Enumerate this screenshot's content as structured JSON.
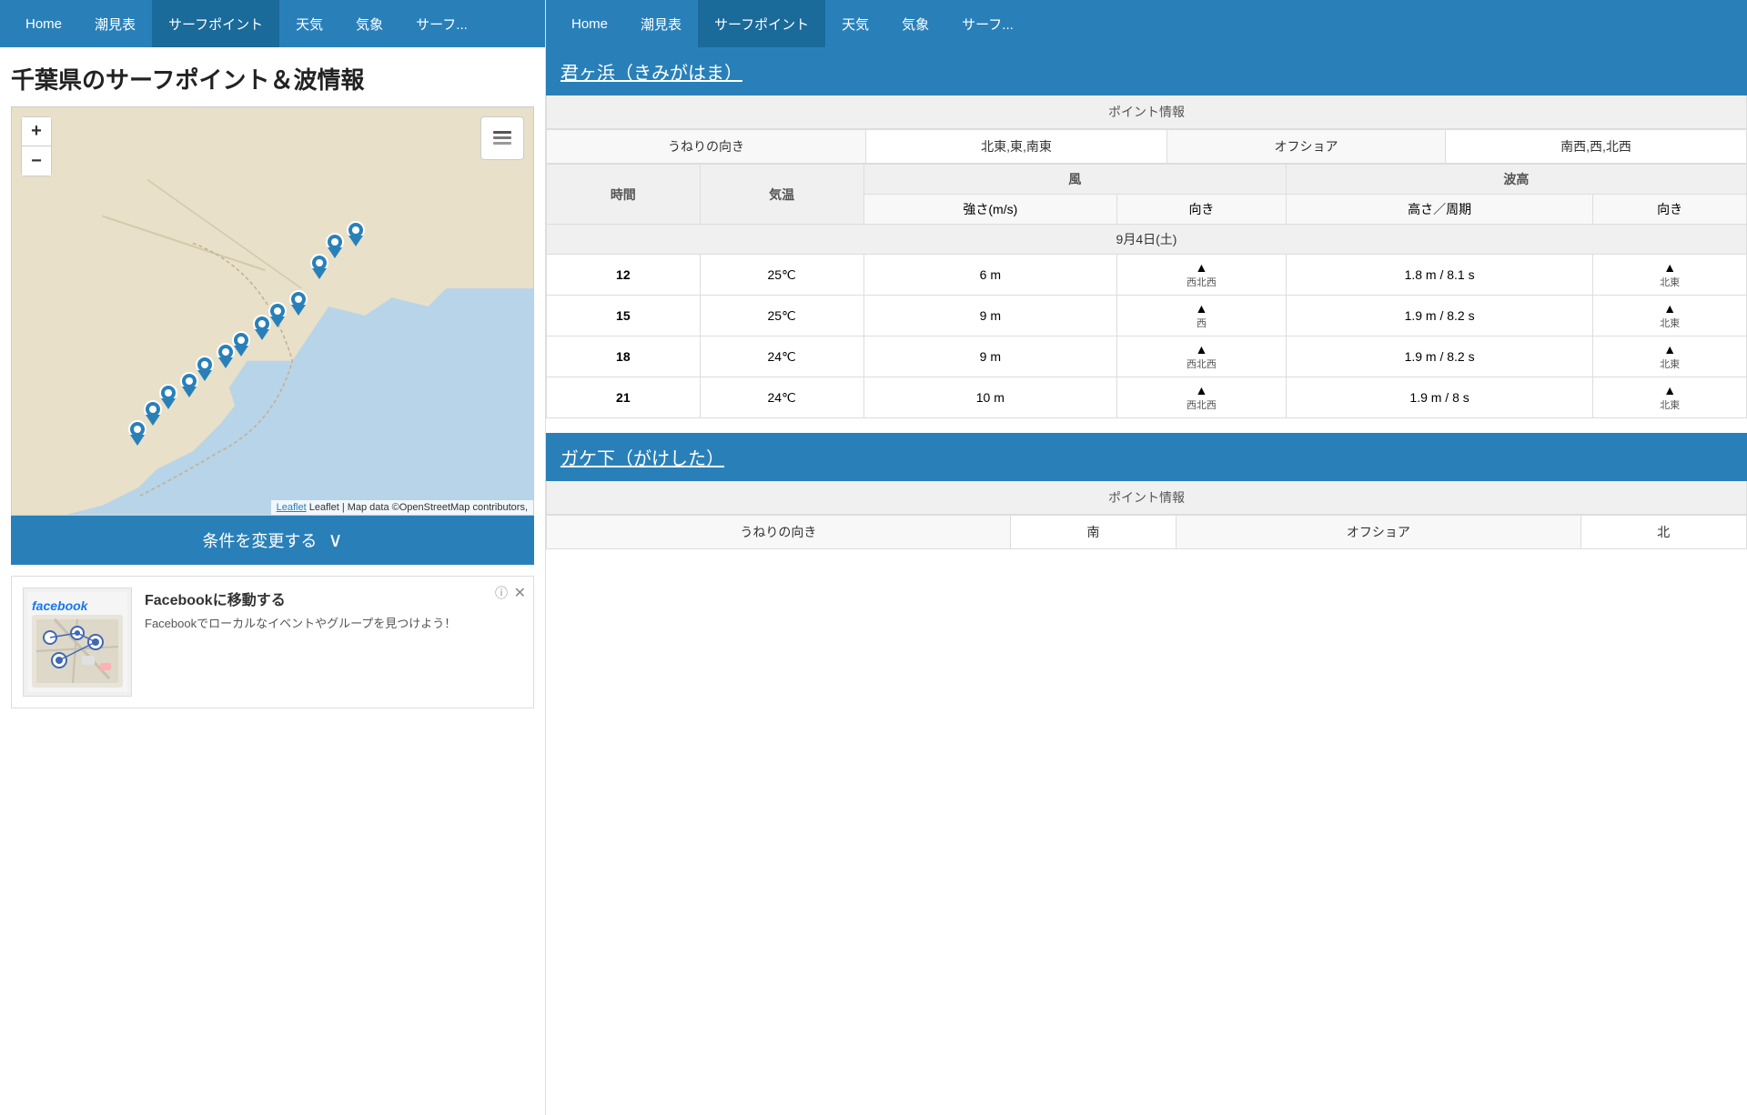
{
  "nav": {
    "items": [
      {
        "label": "Home",
        "active": false
      },
      {
        "label": "潮見表",
        "active": false
      },
      {
        "label": "サーフポイント",
        "active": true
      },
      {
        "label": "天気",
        "active": false
      },
      {
        "label": "気象",
        "active": false
      },
      {
        "label": "サーフ...",
        "active": false
      }
    ]
  },
  "left": {
    "page_title": "千葉県のサーフポイント＆波情報",
    "map": {
      "zoom_plus": "+",
      "zoom_minus": "−",
      "attribution": "Leaflet | Map data ©OpenStreetMap contributors,"
    },
    "condition_bar": {
      "label": "条件を変更する",
      "chevron": "∨"
    },
    "ad": {
      "info_icon": "ⓘ",
      "close_icon": "✕",
      "brand": "facebook",
      "title": "Facebookに移動する",
      "description": "Facebookでローカルなイベントやグループを見つけよう！"
    }
  },
  "right": {
    "spots": [
      {
        "id": "kimigahama",
        "title": "君ヶ浜（きみがはま）",
        "point_info_label": "ポイント情報",
        "swell_label": "うねりの向き",
        "swell_good": "北東,東,南東",
        "offshore_label": "オフショア",
        "offshore_dir": "南西,西,北西",
        "date_label": "9月4日(土)",
        "headers": {
          "wind_group": "風",
          "wave_group": "波高",
          "time": "時間",
          "temp": "気温",
          "strength": "強さ(m/s)",
          "wind_dir": "向き",
          "wave_height": "高さ／周期",
          "wave_dir": "向き"
        },
        "rows": [
          {
            "time": "12",
            "temp": "25℃",
            "strength": "6 m",
            "wind_dir_arrow": "▲",
            "wind_dir_label": "西北西",
            "wave_height": "1.8 m / 8.1 s",
            "wave_dir_arrow": "▲",
            "wave_dir_label": "北東"
          },
          {
            "time": "15",
            "temp": "25℃",
            "strength": "9 m",
            "wind_dir_arrow": "▲",
            "wind_dir_label": "西",
            "wave_height": "1.9 m / 8.2 s",
            "wave_dir_arrow": "▲",
            "wave_dir_label": "北東"
          },
          {
            "time": "18",
            "temp": "24℃",
            "strength": "9 m",
            "wind_dir_arrow": "▲",
            "wind_dir_label": "西北西",
            "wave_height": "1.9 m / 8.2 s",
            "wave_dir_arrow": "▲",
            "wave_dir_label": "北東"
          },
          {
            "time": "21",
            "temp": "24℃",
            "strength": "10 m",
            "wind_dir_arrow": "▲",
            "wind_dir_label": "西北西",
            "wave_height": "1.9 m / 8 s",
            "wave_dir_arrow": "▲",
            "wave_dir_label": "北東"
          }
        ]
      },
      {
        "id": "gakeshita",
        "title": "ガケ下（がけした）",
        "point_info_label": "ポイント情報",
        "swell_label": "うねりの向き",
        "swell_good": "南",
        "offshore_label": "オフショア",
        "offshore_dir": "北"
      }
    ]
  }
}
